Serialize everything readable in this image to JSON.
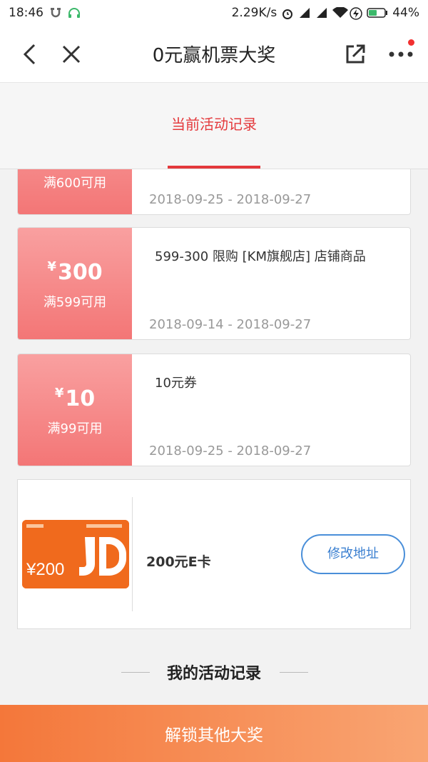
{
  "status_bar": {
    "time": "18:46",
    "net_speed": "2.29K/s",
    "battery": "44%"
  },
  "nav": {
    "title": "0元赢机票大奖"
  },
  "tabs": [
    {
      "label": "当前活动记录",
      "active": true
    }
  ],
  "coupons": [
    {
      "amount": "",
      "condition": "满600可用",
      "description": "",
      "date": "2018-09-25 - 2018-09-27"
    },
    {
      "amount": "300",
      "currency": "¥",
      "condition": "满599可用",
      "description": "599-300 限购 [KM旗舰店] 店铺商品",
      "date": "2018-09-14 - 2018-09-27"
    },
    {
      "amount": "10",
      "currency": "¥",
      "condition": "满99可用",
      "description": "10元券",
      "date": "2018-09-25 - 2018-09-27"
    }
  ],
  "ecard": {
    "name": "200元E卡",
    "card_value": "¥200",
    "card_brand": "JD",
    "button_label": "修改地址"
  },
  "section_title": "我的活动记录",
  "bottom_button": "解锁其他大奖",
  "colors": {
    "accent_red": "#e4393c",
    "coupon_pink": "#f37676",
    "link_blue": "#3a7fd0",
    "bottom_orange": "#f4773a"
  }
}
